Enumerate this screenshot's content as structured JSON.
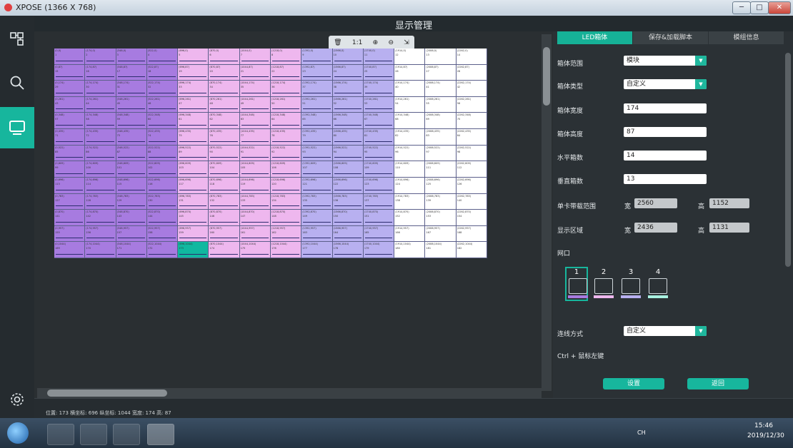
{
  "window": {
    "title": "XPOSE (1366 X 768)",
    "min_label": "─",
    "max_label": "□",
    "close_label": "✕"
  },
  "app": {
    "header": "显示管理"
  },
  "nav": {
    "items": [
      "topology-icon",
      "search-icon",
      "display-icon",
      "settings-icon"
    ],
    "active": "display-icon"
  },
  "toolbar": {
    "items": [
      "🗑",
      "1:1",
      "⊕",
      "⊖",
      "⇲"
    ]
  },
  "grid": {
    "cols": 14,
    "rows": 13,
    "x_coords": [
      0,
      174,
      348,
      522,
      696,
      870,
      1044,
      1218,
      1392,
      1566,
      1740,
      1914,
      2088,
      2262
    ],
    "y_coords": [
      0,
      87,
      174,
      261,
      348,
      435,
      522,
      609,
      696,
      783,
      870,
      957,
      1044
    ],
    "colors": {
      "port1": "#a77be0",
      "port2": "#eeb7ee",
      "port3": "#b8b0f0",
      "selected": "#10b8a0",
      "none": "#ffffff"
    },
    "selected_index": 173
  },
  "tabs": [
    "LED箱体",
    "保存&加载脚本",
    "模组信息"
  ],
  "form": {
    "cabinet_range_label": "箱体范围",
    "cabinet_range_value": "模块",
    "cabinet_type_label": "箱体类型",
    "cabinet_type_value": "自定义",
    "cabinet_width_label": "箱体宽度",
    "cabinet_width_value": "174",
    "cabinet_height_label": "箱体高度",
    "cabinet_height_value": "87",
    "h_count_label": "水平箱数",
    "h_count_value": "14",
    "v_count_label": "垂直箱数",
    "v_count_value": "13",
    "card_range_label": "单卡带载范围",
    "card_w_label": "宽",
    "card_w_value": "2560",
    "card_h_label": "高",
    "card_h_value": "1152",
    "display_area_label": "显示区域",
    "area_w_label": "宽",
    "area_w_value": "2436",
    "area_h_label": "高",
    "area_h_value": "1131",
    "port_label": "网口",
    "ports": [
      "1",
      "2",
      "3",
      "4"
    ],
    "port_colors": [
      "#a77be0",
      "#eeb7ee",
      "#b8b0f0",
      "#a8f0e0"
    ],
    "connect_label": "连线方式",
    "connect_value": "自定义",
    "hint": "Ctrl + 鼠标左键",
    "set_button": "设置",
    "back_button": "返回"
  },
  "status": {
    "text": "位置: 173   横坐标: 696   纵坐标: 1044   宽度: 174   高: 87"
  },
  "taskbar": {
    "lang": "CH",
    "time": "15:46",
    "date": "2019/12/30"
  }
}
